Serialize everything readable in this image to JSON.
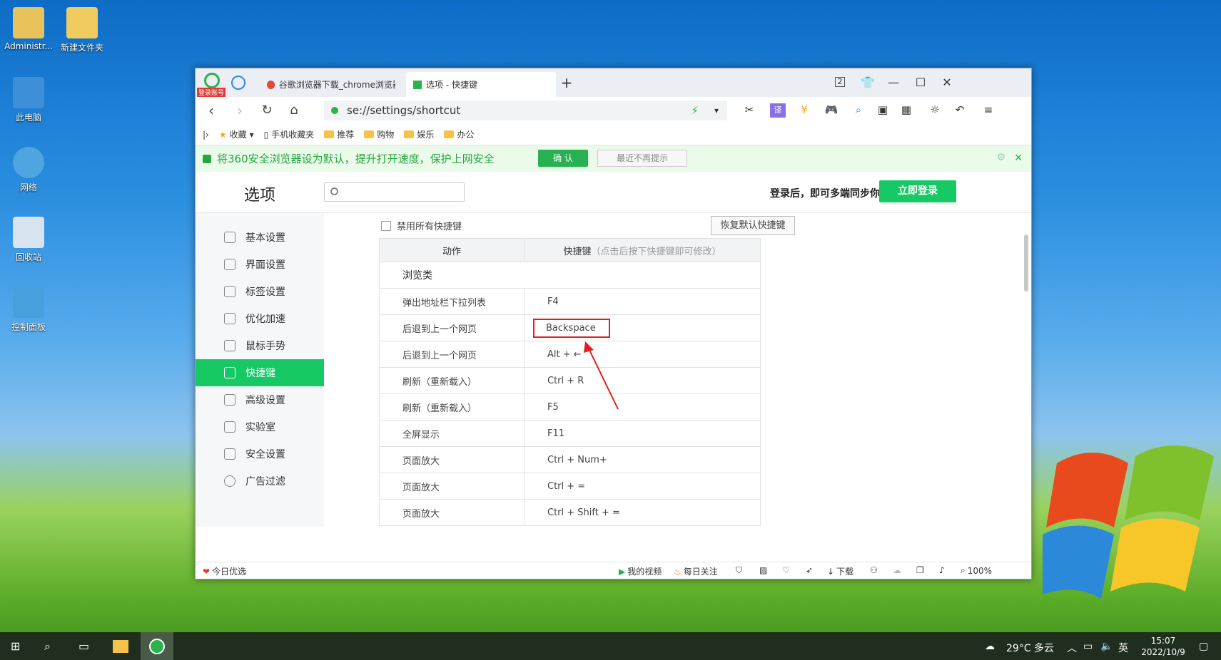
{
  "desktop": {
    "icons": [
      {
        "label": "Administr..."
      },
      {
        "label": "新建文件夹"
      },
      {
        "label": "此电脑"
      },
      {
        "label": "网络"
      },
      {
        "label": "回收站"
      },
      {
        "label": "控制面板"
      }
    ]
  },
  "browser": {
    "login_badge": "登录账号",
    "tabs": [
      {
        "label": "谷歌浏览器下载_chrome浏览器官"
      },
      {
        "label": "选项 - 快捷键"
      }
    ],
    "new_tab": "+",
    "badge_count": "2",
    "address": "se://settings/shortcut",
    "favorites": [
      {
        "label": "收藏"
      },
      {
        "label": "手机收藏夹"
      },
      {
        "label": "推荐"
      },
      {
        "label": "购物"
      },
      {
        "label": "娱乐"
      },
      {
        "label": "办公"
      }
    ],
    "notice": {
      "text": "将360安全浏览器设为默认，提升打开速度，保护上网安全",
      "ok": "确 认",
      "later": "最近不再提示"
    },
    "options": {
      "title": "选项",
      "sync_text": "登录后，即可多端同步你的设置",
      "login_btn": "立即登录",
      "sidebar": [
        {
          "label": "基本设置"
        },
        {
          "label": "界面设置"
        },
        {
          "label": "标签设置"
        },
        {
          "label": "优化加速"
        },
        {
          "label": "鼠标手势"
        },
        {
          "label": "快捷键"
        },
        {
          "label": "高级设置"
        },
        {
          "label": "实验室"
        },
        {
          "label": "安全设置"
        },
        {
          "label": "广告过滤"
        }
      ],
      "disable_all": "禁用所有快捷键",
      "restore_btn": "恢复默认快捷键",
      "table": {
        "col_action": "动作",
        "col_key": "快捷键",
        "col_hint": "（点击后按下快捷键即可修改）",
        "category": "浏览类",
        "rows": [
          {
            "action": "弹出地址栏下拉列表",
            "key": "F4"
          },
          {
            "action": "后退到上一个网页",
            "key": "Backspace"
          },
          {
            "action": "后退到上一个网页",
            "key": "Alt + ←"
          },
          {
            "action": "刷新（重新载入）",
            "key": "Ctrl + R"
          },
          {
            "action": "刷新（重新载入）",
            "key": "F5"
          },
          {
            "action": "全屏显示",
            "key": "F11"
          },
          {
            "action": "页面放大",
            "key": "Ctrl + Num+"
          },
          {
            "action": "页面放大",
            "key": "Ctrl + ="
          },
          {
            "action": "页面放大",
            "key": "Ctrl + Shift + ="
          }
        ]
      }
    },
    "statusbar": {
      "today": "今日优选",
      "video": "我的视频",
      "daily": "每日关注",
      "download": "下载",
      "zoom": "100%"
    }
  },
  "taskbar": {
    "weather": "29°C 多云",
    "ime": "英",
    "time": "15:07",
    "date": "2022/10/9"
  },
  "colors": {
    "accent": "#16c964",
    "highlight": "#e02020"
  }
}
